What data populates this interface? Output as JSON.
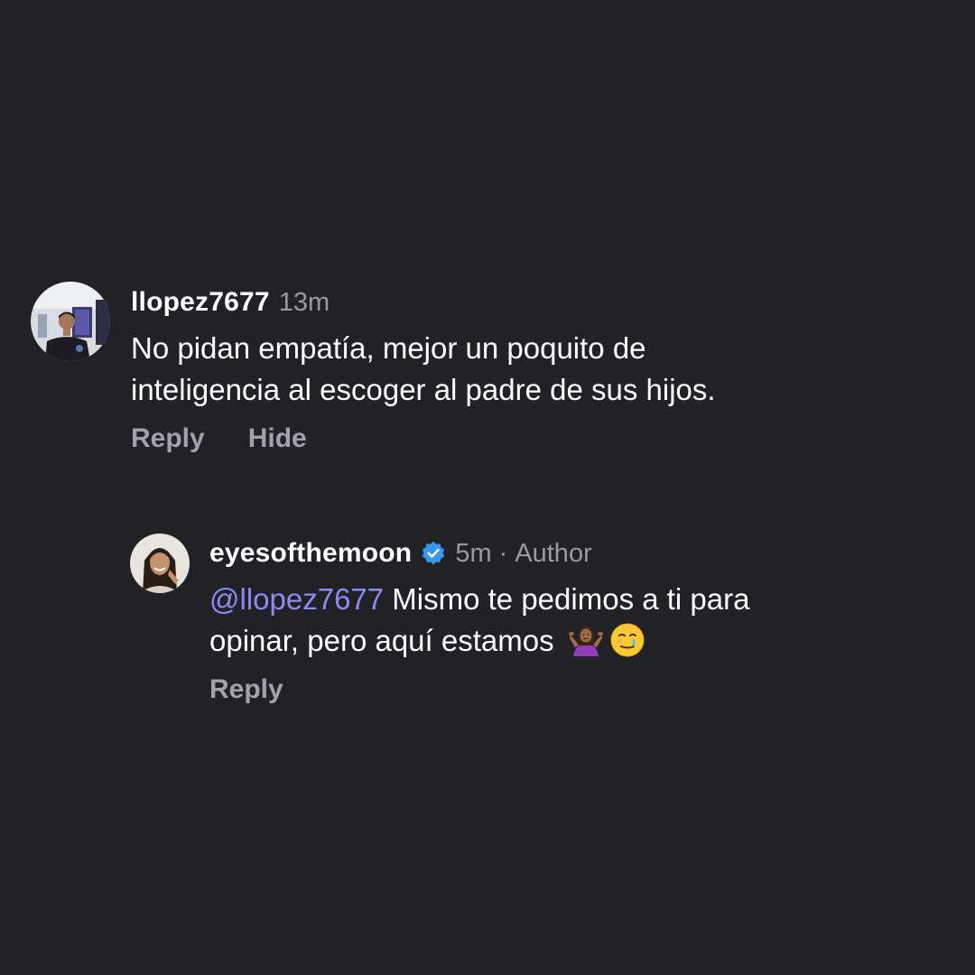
{
  "comments": [
    {
      "username": "llopez7677",
      "time": "13m",
      "text": "No pidan empatía, mejor un poquito de\ninteligencia al escoger al padre de sus hijos.",
      "actions": {
        "reply": "Reply",
        "hide": "Hide"
      }
    }
  ],
  "reply": {
    "username": "eyesofthemoon",
    "verified_icon": "verified-badge-icon",
    "time": "5m",
    "separator": "·",
    "author_label": "Author",
    "mention": "@llopez7677",
    "text_line1": " Mismo te pedimos a ti para\nopinar, pero aquí estamos",
    "emojis": [
      "person-shrugging-emoji",
      "smiling-face-with-tear-emoji"
    ],
    "actions": {
      "reply": "Reply"
    }
  },
  "colors": {
    "background": "#212126",
    "primary_text": "#ffffff",
    "secondary_text": "#9a9aa2",
    "mention": "#8b8bf3",
    "verified": "#3897f0"
  }
}
